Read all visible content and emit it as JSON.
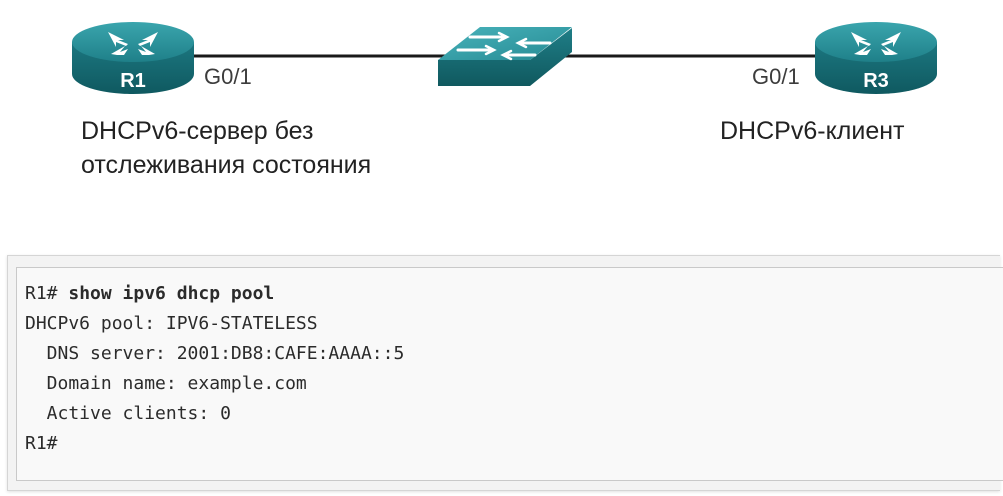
{
  "topology": {
    "router_left": {
      "label": "R1",
      "port": "G0/1"
    },
    "router_right": {
      "label": "R3",
      "port": "G0/1"
    },
    "switch": {
      "icon": "switch-icon"
    },
    "link_color": "#1a1a1a",
    "device_color": "#2a8c95"
  },
  "captions": {
    "r1_line1": "DHCPv6-сервер без",
    "r1_line2": "отслеживания состояния",
    "r3_line1": "DHCPv6-клиент"
  },
  "terminal": {
    "prompt1": "R1# ",
    "command": "show ipv6 dhcp pool",
    "lines": [
      "DHCPv6 pool: IPV6-STATELESS",
      "  DNS server: 2001:DB8:CAFE:AAAA::5",
      "  Domain name: example.com",
      "  Active clients: 0"
    ],
    "prompt_end": "R1#"
  }
}
